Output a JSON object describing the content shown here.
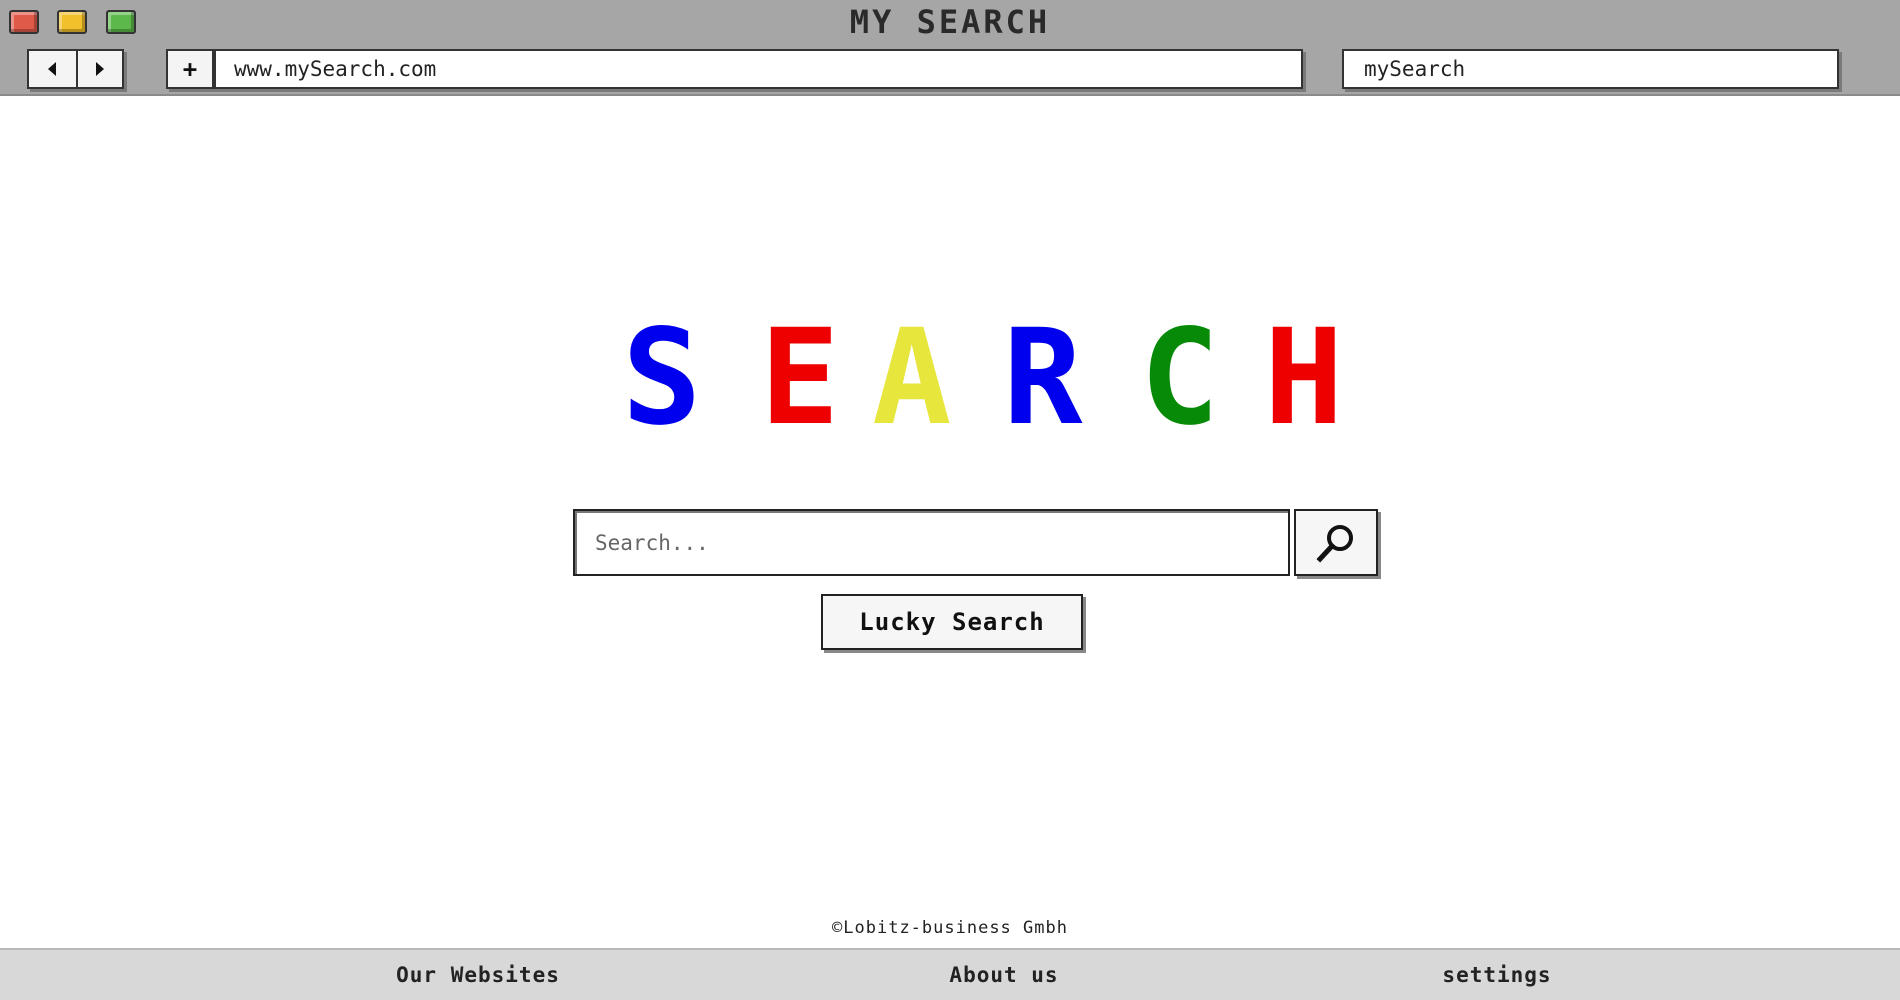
{
  "window": {
    "title": "MY SEARCH",
    "controls": [
      "close",
      "minimize",
      "maximize"
    ],
    "control_colors": {
      "close": "#e05a4a",
      "minimize": "#f2c02a",
      "maximize": "#5cb84a"
    }
  },
  "toolbar": {
    "back_icon": "triangle-left-icon",
    "forward_icon": "triangle-right-icon",
    "new_tab_label": "+",
    "url": "www.mySearch.com",
    "search_engine_field": "mySearch"
  },
  "logo": {
    "letters": [
      {
        "char": "S",
        "color": "#0000ee"
      },
      {
        "char": "E",
        "color": "#ee0000"
      },
      {
        "char": "A",
        "color": "#e6e63c"
      },
      {
        "char": "R",
        "color": "#0000ee"
      },
      {
        "char": "C",
        "color": "#078a07"
      },
      {
        "char": "H",
        "color": "#ee0000"
      }
    ]
  },
  "search": {
    "placeholder": "Search...",
    "button_icon": "magnifier-icon",
    "lucky_label": "Lucky Search"
  },
  "footer": {
    "copyright": "©Lobitz-business Gmbh",
    "links": [
      "Our Websites",
      "About us",
      "settings"
    ]
  }
}
